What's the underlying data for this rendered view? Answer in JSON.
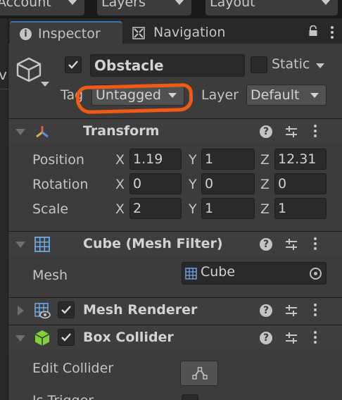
{
  "topbar": {
    "account_label": "Account",
    "layers_label": "Layers",
    "layout_label": "Layout"
  },
  "leftstrip": {
    "fragment": "v"
  },
  "tabs": {
    "inspector_label": "Inspector",
    "navigation_label": "Navigation"
  },
  "gameobject": {
    "active": true,
    "name": "Obstacle",
    "static_label": "Static",
    "static_checked": false,
    "tag_label": "Tag",
    "tag_value": "Untagged",
    "layer_label": "Layer",
    "layer_value": "Default"
  },
  "transform": {
    "title": "Transform",
    "position_label": "Position",
    "rotation_label": "Rotation",
    "scale_label": "Scale",
    "axis_x": "X",
    "axis_y": "Y",
    "axis_z": "Z",
    "position": {
      "x": "1.19",
      "y": "1",
      "z": "12.31"
    },
    "rotation": {
      "x": "0",
      "y": "0",
      "z": "0"
    },
    "scale": {
      "x": "2",
      "y": "1",
      "z": "1"
    }
  },
  "mesh_filter": {
    "title": "Cube (Mesh Filter)",
    "mesh_label": "Mesh",
    "mesh_value": "Cube"
  },
  "mesh_renderer": {
    "title": "Mesh Renderer",
    "enabled": true
  },
  "box_collider": {
    "title": "Box Collider",
    "enabled": true,
    "edit_collider_label": "Edit Collider",
    "is_trigger_label": "Is Trigger"
  },
  "colors": {
    "panel_bg": "#3c3c3c",
    "field_bg": "#2a2a2a",
    "annotation": "#f05a12",
    "transform_icon": "#e0603a"
  }
}
